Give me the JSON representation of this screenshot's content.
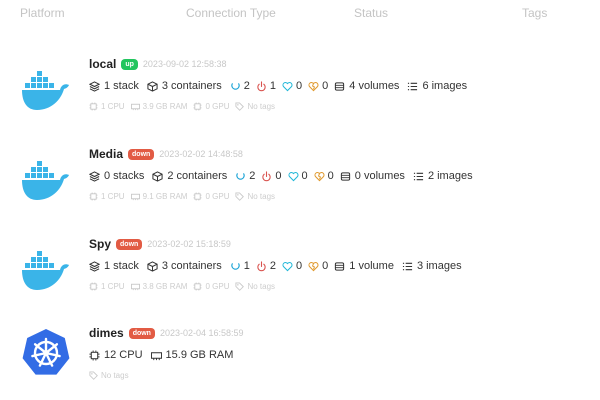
{
  "header": {
    "platform": "Platform",
    "connection_type": "Connection Type",
    "status": "Status",
    "tags": "Tags"
  },
  "colors": {
    "docker_blue": "#3ab4e8",
    "k8s_blue": "#326ce5",
    "up": "#22c55e",
    "down": "#e25b44",
    "healthy": "#1aa3d6",
    "unhealthy": "#d9534f",
    "running": "#22b8d8",
    "stopped": "#e09a2f"
  },
  "environments": [
    {
      "name": "local",
      "status": "up",
      "time": "2023-09-02 12:58:38",
      "stacks": "1 stack",
      "containers": "3 containers",
      "healthy": "2",
      "unhealthy": "1",
      "running": "0",
      "stopped": "0",
      "volumes": "4 volumes",
      "images": "6 images",
      "cpu": "1 CPU",
      "ram": "3.9 GB RAM",
      "gpu": "0 GPU",
      "tags": "No tags",
      "logo": "docker-whale"
    },
    {
      "name": "Media",
      "status": "down",
      "time": "2023-02-02 14:48:58",
      "stacks": "0 stacks",
      "containers": "2 containers",
      "healthy": "2",
      "unhealthy": "0",
      "running": "0",
      "stopped": "0",
      "volumes": "0 volumes",
      "images": "2 images",
      "cpu": "1 CPU",
      "ram": "9.1 GB RAM",
      "gpu": "0 GPU",
      "tags": "No tags",
      "logo": "docker-whale"
    },
    {
      "name": "Spy",
      "status": "down",
      "time": "2023-02-02 15:18:59",
      "stacks": "1 stack",
      "containers": "3 containers",
      "healthy": "1",
      "unhealthy": "2",
      "running": "0",
      "stopped": "0",
      "volumes": "1 volume",
      "images": "3 images",
      "cpu": "1 CPU",
      "ram": "3.8 GB RAM",
      "gpu": "0 GPU",
      "tags": "No tags",
      "logo": "docker-whale"
    },
    {
      "name": "dimes",
      "status": "down",
      "time": "2023-02-04 16:58:59",
      "cpu": "12 CPU",
      "ram": "15.9 GB RAM",
      "tags": "No tags",
      "logo": "kubernetes-wheel"
    }
  ]
}
